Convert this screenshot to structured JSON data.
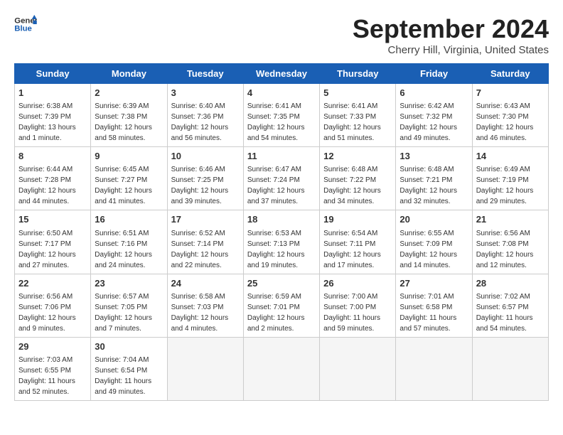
{
  "header": {
    "logo_line1": "General",
    "logo_line2": "Blue",
    "title": "September 2024",
    "subtitle": "Cherry Hill, Virginia, United States"
  },
  "days_of_week": [
    "Sunday",
    "Monday",
    "Tuesday",
    "Wednesday",
    "Thursday",
    "Friday",
    "Saturday"
  ],
  "weeks": [
    [
      {
        "day": 1,
        "info": "Sunrise: 6:38 AM\nSunset: 7:39 PM\nDaylight: 13 hours\nand 1 minute."
      },
      {
        "day": 2,
        "info": "Sunrise: 6:39 AM\nSunset: 7:38 PM\nDaylight: 12 hours\nand 58 minutes."
      },
      {
        "day": 3,
        "info": "Sunrise: 6:40 AM\nSunset: 7:36 PM\nDaylight: 12 hours\nand 56 minutes."
      },
      {
        "day": 4,
        "info": "Sunrise: 6:41 AM\nSunset: 7:35 PM\nDaylight: 12 hours\nand 54 minutes."
      },
      {
        "day": 5,
        "info": "Sunrise: 6:41 AM\nSunset: 7:33 PM\nDaylight: 12 hours\nand 51 minutes."
      },
      {
        "day": 6,
        "info": "Sunrise: 6:42 AM\nSunset: 7:32 PM\nDaylight: 12 hours\nand 49 minutes."
      },
      {
        "day": 7,
        "info": "Sunrise: 6:43 AM\nSunset: 7:30 PM\nDaylight: 12 hours\nand 46 minutes."
      }
    ],
    [
      {
        "day": 8,
        "info": "Sunrise: 6:44 AM\nSunset: 7:28 PM\nDaylight: 12 hours\nand 44 minutes."
      },
      {
        "day": 9,
        "info": "Sunrise: 6:45 AM\nSunset: 7:27 PM\nDaylight: 12 hours\nand 41 minutes."
      },
      {
        "day": 10,
        "info": "Sunrise: 6:46 AM\nSunset: 7:25 PM\nDaylight: 12 hours\nand 39 minutes."
      },
      {
        "day": 11,
        "info": "Sunrise: 6:47 AM\nSunset: 7:24 PM\nDaylight: 12 hours\nand 37 minutes."
      },
      {
        "day": 12,
        "info": "Sunrise: 6:48 AM\nSunset: 7:22 PM\nDaylight: 12 hours\nand 34 minutes."
      },
      {
        "day": 13,
        "info": "Sunrise: 6:48 AM\nSunset: 7:21 PM\nDaylight: 12 hours\nand 32 minutes."
      },
      {
        "day": 14,
        "info": "Sunrise: 6:49 AM\nSunset: 7:19 PM\nDaylight: 12 hours\nand 29 minutes."
      }
    ],
    [
      {
        "day": 15,
        "info": "Sunrise: 6:50 AM\nSunset: 7:17 PM\nDaylight: 12 hours\nand 27 minutes."
      },
      {
        "day": 16,
        "info": "Sunrise: 6:51 AM\nSunset: 7:16 PM\nDaylight: 12 hours\nand 24 minutes."
      },
      {
        "day": 17,
        "info": "Sunrise: 6:52 AM\nSunset: 7:14 PM\nDaylight: 12 hours\nand 22 minutes."
      },
      {
        "day": 18,
        "info": "Sunrise: 6:53 AM\nSunset: 7:13 PM\nDaylight: 12 hours\nand 19 minutes."
      },
      {
        "day": 19,
        "info": "Sunrise: 6:54 AM\nSunset: 7:11 PM\nDaylight: 12 hours\nand 17 minutes."
      },
      {
        "day": 20,
        "info": "Sunrise: 6:55 AM\nSunset: 7:09 PM\nDaylight: 12 hours\nand 14 minutes."
      },
      {
        "day": 21,
        "info": "Sunrise: 6:56 AM\nSunset: 7:08 PM\nDaylight: 12 hours\nand 12 minutes."
      }
    ],
    [
      {
        "day": 22,
        "info": "Sunrise: 6:56 AM\nSunset: 7:06 PM\nDaylight: 12 hours\nand 9 minutes."
      },
      {
        "day": 23,
        "info": "Sunrise: 6:57 AM\nSunset: 7:05 PM\nDaylight: 12 hours\nand 7 minutes."
      },
      {
        "day": 24,
        "info": "Sunrise: 6:58 AM\nSunset: 7:03 PM\nDaylight: 12 hours\nand 4 minutes."
      },
      {
        "day": 25,
        "info": "Sunrise: 6:59 AM\nSunset: 7:01 PM\nDaylight: 12 hours\nand 2 minutes."
      },
      {
        "day": 26,
        "info": "Sunrise: 7:00 AM\nSunset: 7:00 PM\nDaylight: 11 hours\nand 59 minutes."
      },
      {
        "day": 27,
        "info": "Sunrise: 7:01 AM\nSunset: 6:58 PM\nDaylight: 11 hours\nand 57 minutes."
      },
      {
        "day": 28,
        "info": "Sunrise: 7:02 AM\nSunset: 6:57 PM\nDaylight: 11 hours\nand 54 minutes."
      }
    ],
    [
      {
        "day": 29,
        "info": "Sunrise: 7:03 AM\nSunset: 6:55 PM\nDaylight: 11 hours\nand 52 minutes."
      },
      {
        "day": 30,
        "info": "Sunrise: 7:04 AM\nSunset: 6:54 PM\nDaylight: 11 hours\nand 49 minutes."
      },
      null,
      null,
      null,
      null,
      null
    ]
  ]
}
